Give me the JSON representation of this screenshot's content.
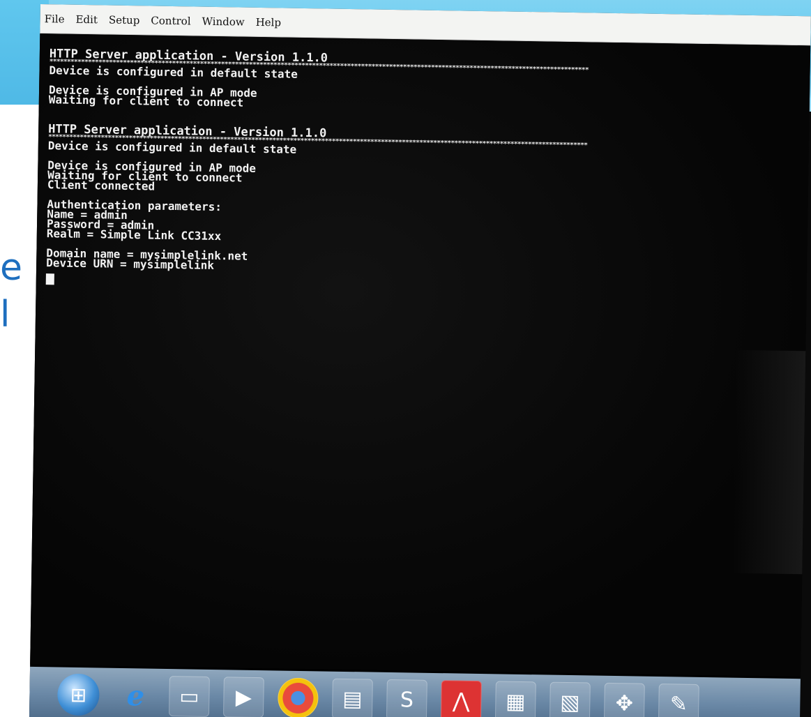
{
  "slide": {
    "fragment_1": "e",
    "fragment_2": "l"
  },
  "window": {
    "menu": [
      "File",
      "Edit",
      "Setup",
      "Control",
      "Window",
      "Help"
    ]
  },
  "terminal": {
    "lines": [
      "HTTP Server application - Version 1.1.0",
      "Device is configured in default state",
      "",
      "Device is configured in AP mode",
      "Waiting for client to connect",
      "",
      "",
      "HTTP Server application - Version 1.1.0",
      "Device is configured in default state",
      "",
      "Device is configured in AP mode",
      "Waiting for client to connect",
      "Client connected",
      "",
      "Authentication parameters:",
      "Name = admin",
      "Password = admin",
      "Realm = Simple Link CC31xx",
      "",
      "Domain name = mysimplelink.net",
      "Device URN = mysimplelink"
    ]
  },
  "taskbar": {
    "items": [
      {
        "icon": "windows-start-icon"
      },
      {
        "icon": "internet-explorer-icon"
      },
      {
        "icon": "file-explorer-icon"
      },
      {
        "icon": "media-player-icon"
      },
      {
        "icon": "chrome-icon"
      },
      {
        "icon": "folder-icon"
      },
      {
        "icon": "skype-icon"
      },
      {
        "icon": "adobe-reader-icon"
      },
      {
        "icon": "app-window-icon"
      },
      {
        "icon": "terminal-app-icon"
      },
      {
        "icon": "network-icon"
      },
      {
        "icon": "notes-icon"
      }
    ]
  }
}
